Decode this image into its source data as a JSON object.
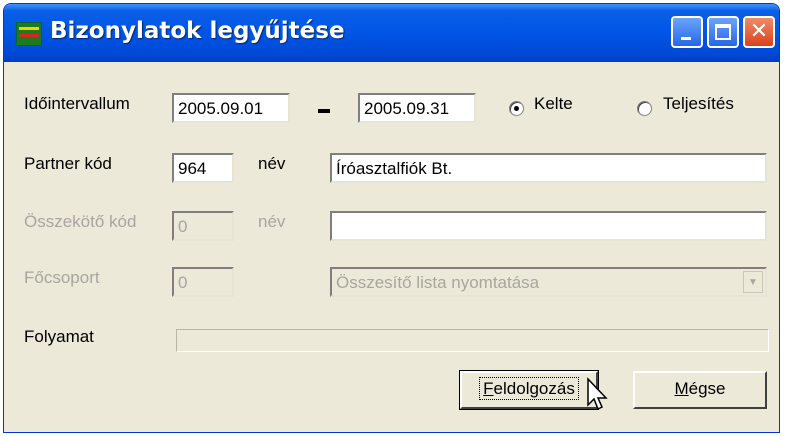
{
  "window": {
    "title": "Bizonylatok legyűjtése",
    "icons": {
      "app": "app-icon",
      "minimize": "minimize-icon",
      "maximize": "maximize-icon",
      "close": "close-icon"
    }
  },
  "interval": {
    "label": "Időintervallum",
    "from": "2005.09.01",
    "to": "2005.09.31",
    "radio_options": [
      {
        "label": "Kelte",
        "checked": true
      },
      {
        "label": "Teljesítés",
        "checked": false
      }
    ]
  },
  "partner": {
    "label": "Partner kód",
    "code": "964",
    "name_label": "név",
    "name": "Íróasztalfiók Bt."
  },
  "linking": {
    "label": "Összekötő kód",
    "code": "0",
    "name_label": "név",
    "name": ""
  },
  "main_group": {
    "label": "Főcsoport",
    "code": "0",
    "combo_value": "Összesítő lista nyomtatása"
  },
  "progress": {
    "label": "Folyamat",
    "value": 0
  },
  "buttons": {
    "process_first": "F",
    "process_rest": "eldolgozás",
    "cancel_first": "M",
    "cancel_rest": "égse"
  },
  "colors": {
    "titlebar": "#0055e5",
    "face": "#ece9d8",
    "disabled_text": "#a7a6a0"
  }
}
